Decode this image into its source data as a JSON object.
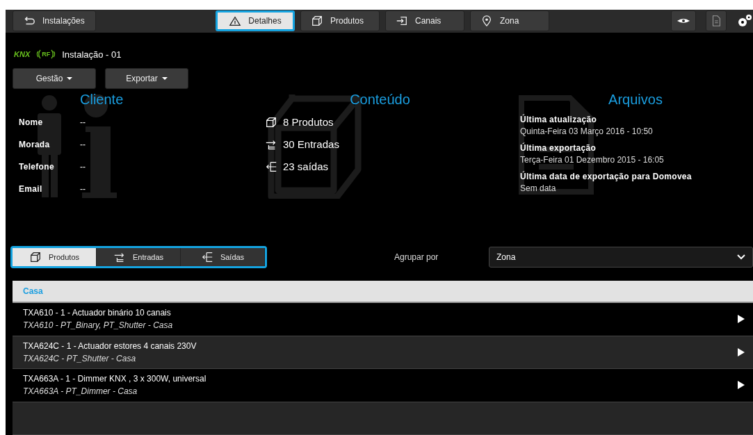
{
  "toolbar": {
    "back_button": "Instalações",
    "tabs": [
      {
        "label": "Detalhes",
        "kind": "details",
        "selected": true
      },
      {
        "label": "Produtos",
        "kind": "products",
        "selected": false
      },
      {
        "label": "Canais",
        "kind": "channels",
        "selected": false
      },
      {
        "label": "Zona",
        "kind": "zone",
        "selected": false
      }
    ]
  },
  "installation": {
    "protocols": [
      "KNX",
      "RF"
    ],
    "name": "Instalação - 01"
  },
  "menus": [
    "Gestão",
    "Exportar"
  ],
  "client": {
    "title": "Cliente",
    "fields": [
      {
        "label": "Nome",
        "value": "--"
      },
      {
        "label": "Morada",
        "value": "--"
      },
      {
        "label": "Telefone",
        "value": "--"
      },
      {
        "label": "Email",
        "value": "--"
      }
    ]
  },
  "content": {
    "title": "Conteúdo",
    "items": [
      {
        "kind": "products",
        "text": "8 Produtos"
      },
      {
        "kind": "inputs",
        "text": "30 Entradas"
      },
      {
        "kind": "outputs",
        "text": "23 saídas"
      }
    ]
  },
  "files": {
    "title": "Arquivos",
    "entries": [
      {
        "label": "Última atualização",
        "value": "Quinta-Feira 03 Março 2016 - 10:50"
      },
      {
        "label": "Última exportação",
        "value": "Terça-Feira 01 Dezembro 2015 - 16:05"
      },
      {
        "label": "Última data de exportação para Domovea",
        "value": "Sem data"
      }
    ]
  },
  "view_tabs": [
    {
      "label": "Produtos",
      "kind": "products",
      "selected": true
    },
    {
      "label": "Entradas",
      "kind": "inputs",
      "selected": false
    },
    {
      "label": "Saídas",
      "kind": "outputs",
      "selected": false
    }
  ],
  "group_by": {
    "label": "Agrupar por",
    "value": "Zona"
  },
  "group": {
    "title": "Casa",
    "rows": [
      {
        "title": "TXA610 - 1 - Actuador binário 10 canais",
        "subtitle": "TXA610 - PT_Binary, PT_Shutter - Casa"
      },
      {
        "title": "TXA624C - 1 - Actuador estores 4 canais 230V",
        "subtitle": "TXA624C - PT_Shutter - Casa"
      },
      {
        "title": "TXA663A - 1 - Dimmer KNX , 3 x 300W, universal",
        "subtitle": "TXA663A - PT_Dimmer - Casa"
      }
    ]
  }
}
